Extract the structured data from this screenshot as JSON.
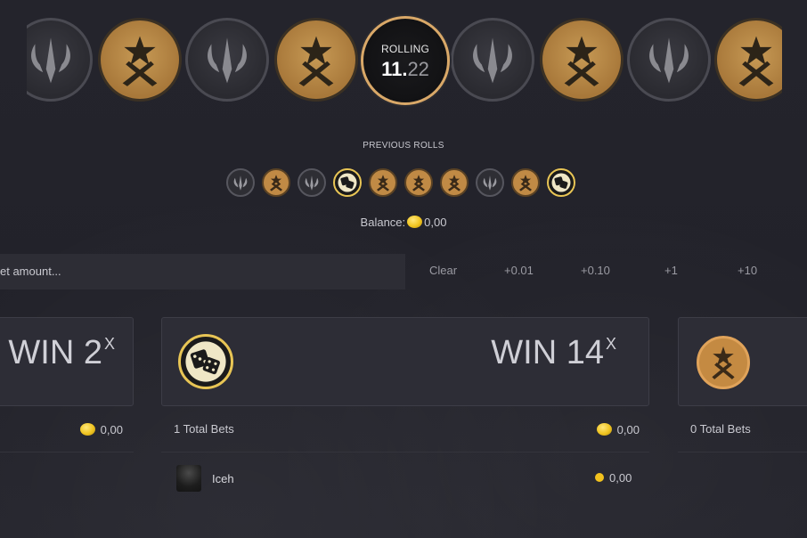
{
  "reel": {
    "coins": [
      "ct",
      "t",
      "ct",
      "t",
      "rolling",
      "ct",
      "t",
      "ct",
      "t"
    ],
    "rolling_label": "ROLLING",
    "rolling_int": "11.",
    "rolling_frac": "22"
  },
  "previous_rolls": {
    "title": "PREVIOUS ROLLS",
    "coins": [
      "ct",
      "t",
      "ct",
      "bonus",
      "t",
      "t",
      "t",
      "ct",
      "t",
      "bonus"
    ]
  },
  "balance": {
    "label": "Balance:",
    "value": "0,00"
  },
  "bet": {
    "placeholder": "Bet amount...",
    "visible_text": "et amount...",
    "buttons": [
      "Clear",
      "+0.01",
      "+0.10",
      "+1",
      "+10"
    ]
  },
  "panels": [
    {
      "id": "ct",
      "win": "WIN 2",
      "mult": "X",
      "total_bets": "",
      "amount": "0,00"
    },
    {
      "id": "bonus",
      "win": "WIN 14",
      "mult": "X",
      "total_bets": "1 Total Bets",
      "amount": "0,00",
      "bets": [
        {
          "user": "Iceh",
          "amount": "0,00"
        }
      ]
    },
    {
      "id": "t",
      "win": "",
      "mult": "",
      "total_bets": "0 Total Bets",
      "amount": ""
    }
  ],
  "colors": {
    "background": "#23232b",
    "panel": "#2d2d36",
    "gold": "#f0c420",
    "t_coin": "#c08a45",
    "ct_coin": "#2e2e34"
  }
}
